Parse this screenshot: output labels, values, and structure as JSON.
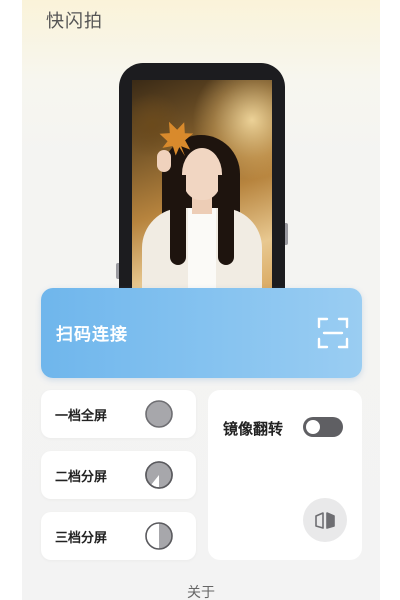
{
  "app": {
    "title": "快闪拍"
  },
  "scan": {
    "label": "扫码连接",
    "icon": "scan-qr-icon"
  },
  "modes": [
    {
      "label": "一档全屏",
      "icon": "full-screen-mode-icon"
    },
    {
      "label": "二档分屏",
      "icon": "half-split-mode-icon"
    },
    {
      "label": "三档分屏",
      "icon": "third-split-mode-icon"
    }
  ],
  "mirror": {
    "label": "镜像翻转",
    "toggle_on": false,
    "flip_icon": "mirror-flip-icon"
  },
  "footer": {
    "about": "关于"
  },
  "colors": {
    "accent": "#7dbef0",
    "toggle_off": "#5f5f63",
    "mode_icon": "#a7a7ab"
  }
}
